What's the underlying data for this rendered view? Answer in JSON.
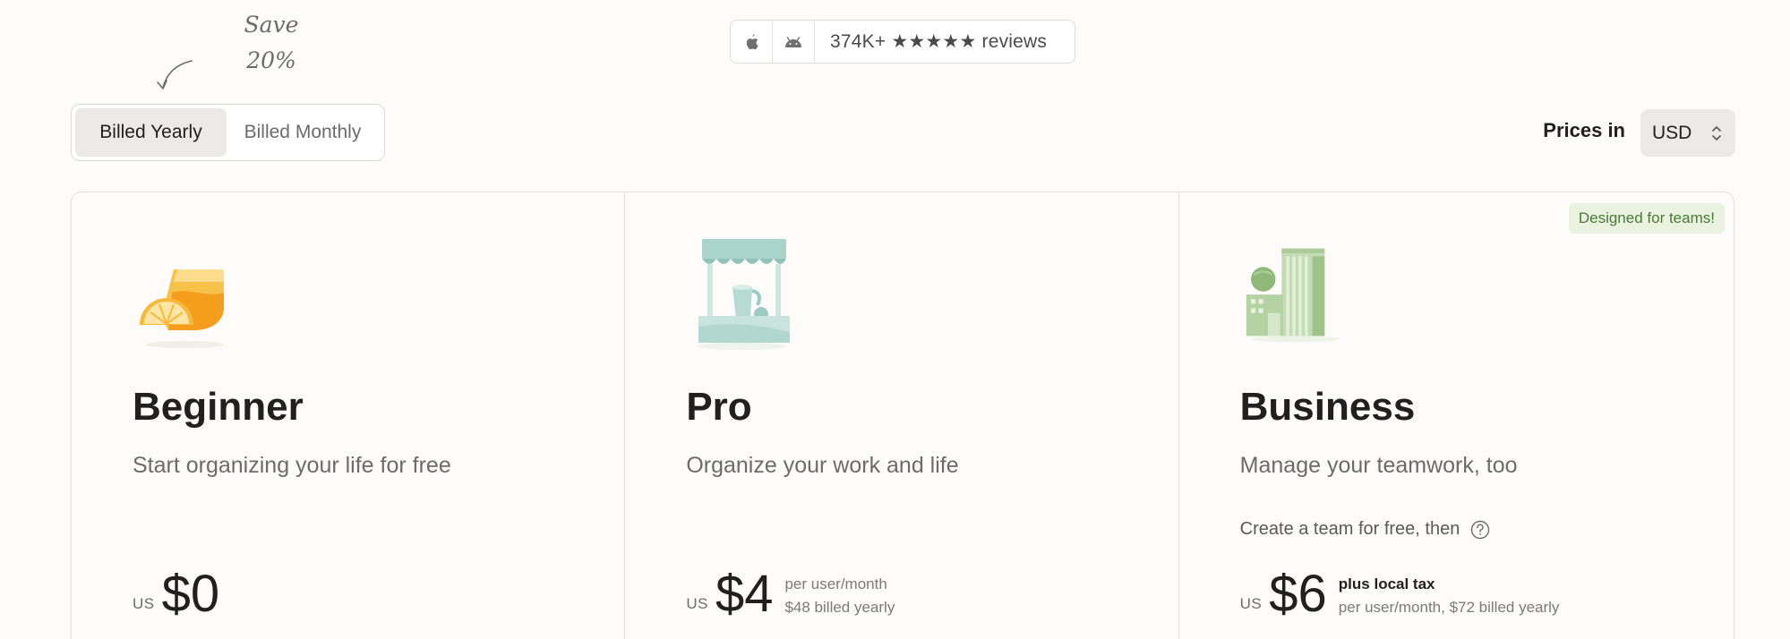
{
  "save_note": {
    "line1": "Save",
    "line2": "20%"
  },
  "rating": {
    "text": "374K+ ★★★★★ reviews",
    "platforms": [
      "apple-icon",
      "android-icon"
    ]
  },
  "billing": {
    "yearly_label": "Billed Yearly",
    "monthly_label": "Billed Monthly",
    "selected": "yearly"
  },
  "currency": {
    "label": "Prices in",
    "value": "USD"
  },
  "plans": [
    {
      "title": "Beginner",
      "subtitle": "Start organizing your life for free",
      "currency_prefix": "US",
      "price": "$0",
      "illustration": "orange-juice-icon"
    },
    {
      "title": "Pro",
      "subtitle": "Organize your work and life",
      "currency_prefix": "US",
      "price": "$4",
      "meta_line1": "per user/month",
      "meta_line2": "$48 billed yearly",
      "illustration": "lemonade-stand-icon"
    },
    {
      "title": "Business",
      "subtitle": "Manage your teamwork, too",
      "badge": "Designed for teams!",
      "team_note": "Create a team for free, then",
      "currency_prefix": "US",
      "price": "$6",
      "meta_line1": "plus local tax",
      "meta_line2": "per user/month, $72 billed yearly",
      "illustration": "office-building-icon"
    }
  ],
  "colors": {
    "background": "#fdfcfa",
    "badge_bg": "#e9f3df",
    "badge_text": "#4a7a35",
    "toggle_active": "#ebeae8"
  }
}
